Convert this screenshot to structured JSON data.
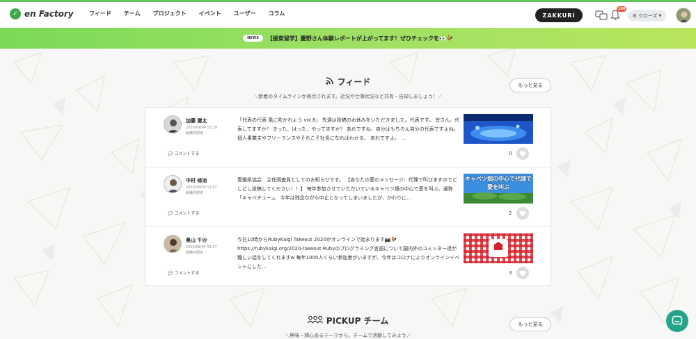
{
  "brand": {
    "logo_text": "en Factory"
  },
  "nav": [
    {
      "label": "フィード"
    },
    {
      "label": "チーム"
    },
    {
      "label": "プロジェクト"
    },
    {
      "label": "イベント"
    },
    {
      "label": "ユーザー"
    },
    {
      "label": "コラム"
    }
  ],
  "header": {
    "zakkuri_label": "ZAKKURI",
    "notification_count": "100",
    "close_label": "クローズ"
  },
  "banner": {
    "tag": "NEWS",
    "text": "【振東留学】慶野さん体験レポートが上がってます！ぜひチェックを👀🐓"
  },
  "feed_section": {
    "title": "フィード",
    "subtitle": "＼新着のタイムラインが表示されます。近況や仕事状況など共有・告知しましょう！／",
    "more_label": "もっと見る",
    "comment_label": "コメントする",
    "items": [
      {
        "name": "加藤 健太",
        "date": "2020/09/04 15:29",
        "scope": "組織内限定",
        "text": "「代表の代表 風に吹かれよう vol.8」 先週は投稿のお休みをいただきました。代表です。 皆さん、代表してますか？ きった、はった、やってますか？ あれですね、自分はもちろん自分の代表ですよね。 個人事業主やフリーランスやそれこそ社長になればわかる、 あれですよ。 …",
        "count": "0"
      },
      {
        "name": "中村 修治",
        "date": "2020/09/04 12:07",
        "scope": "組織内限定",
        "text": "愛媛県協会　主任調査員としてのお知らせです。 【あなたの愛のメッセージ、代理で叫びますのでどしどし投稿してください！！】 毎年参加させていただいているキャベツ畑の中心で愛を叫ぶ、通称「キャベチュー」。 今年は残念ながら中止となってしまいましたが、かわりに…",
        "thumb_text": "キャベツ畑の中心で代理で愛を叫ぶ",
        "count": "2"
      },
      {
        "name": "奥山 千沙",
        "date": "2020/09/04 09:57",
        "scope": "組織内限定",
        "text": "今日10時からRubyKaigi Takeout 2020がオンラインで始まります📷🐓 https://rubykaigi.org/2020-takeout Rubyのプログラミング言語について国内外のコミッター達が難しい話をしてくれますw 毎年1000人くらい参加者がいますが、今年はコロナによりオンラインイベントにした…",
        "count": "3"
      }
    ]
  },
  "pickup_section": {
    "title": "PICKUP チーム",
    "subtitle": "＼興味・関心あるテーマから、チームで活動してみよう／",
    "more_label": "もっと見る"
  },
  "colors": {
    "brand_green": "#3ea94a",
    "banner_start": "#7bd957",
    "banner_end": "#b9e55d",
    "zakkuri_bg": "#222222",
    "fab": "#23a58b"
  }
}
